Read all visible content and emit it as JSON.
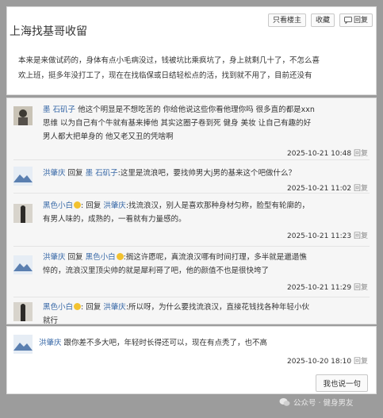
{
  "post": {
    "title": "上海找基哥收留",
    "buttons": {
      "only_author": "只看楼主",
      "favorite": "收藏",
      "reply": "回复"
    },
    "body_line1": "本来是来做试药的，身体有点小毛病没过，钱被坑比乘疯坑了，身上就剩几十了，不怎么喜",
    "body_line2": "欢上班，挺多年没打工了，现在在找临保或日结轻松点的活，找到就不用了，目前还没有"
  },
  "replies": [
    {
      "user": "墨 石矶子",
      "text_line1": "他这个明显是不想吃苦的 你给他说这些你看他理你吗 很多直的都是xxn",
      "text_line2": "思维 以为自己有个牛就有基来捧他 其实这圈子卷到死 健身 美妆 让自己有趣的好",
      "text_line3": "男人都大把单身的 他又老又丑的凭啥啊",
      "time": "2025-10-21 10:48",
      "reply_label": "回复"
    },
    {
      "user": "洪肇庆",
      "reply_to_prefix": "回复",
      "reply_to": "墨 石矶子",
      "text": ":这里是流浪吧，要找帅男大j男的基来这个吧做什么？",
      "time": "2025-10-21 11:02",
      "reply_label": "回复"
    },
    {
      "user": "黑色小白",
      "reply_to_prefix": "回复",
      "reply_to": "洪肇庆",
      "text_line1": ":找流浪汉，别人是喜欢那种身材匀称，脸型有轮廓的，",
      "text_line2": "有男人味的，成熟的，一看就有力量感的。",
      "time": "2025-10-21 11:23",
      "reply_label": "回复"
    },
    {
      "user": "洪肇庆",
      "reply_to_prefix": "回复",
      "reply_to": "黑色小白",
      "text_line1": ":搁这许愿呢，真流浪汉哪有时间打理，多半就是邋遢憔",
      "text_line2": "悴的，流浪汉里顶尖帅的就是犀利哥了吧，他的颜值不也是很快垮了",
      "time": "2025-10-21 11:29",
      "reply_label": "回复"
    },
    {
      "user": "黑色小白",
      "reply_to_prefix": "回复",
      "reply_to": "洪肇庆",
      "text_line1": ":所以呀，为什么要找流浪汉，直接花钱找各种年轻小伙",
      "text_line2": "就行"
    }
  ],
  "bottom_reply": {
    "user": "洪肇庆",
    "text": "跟你差不多大吧，年轻时长得还可以，现在有点秃了，也不高",
    "time": "2025-10-20 18:10",
    "reply_label": "回复",
    "say_button": "我也说一句"
  },
  "watermark": {
    "text": "公众号 · 健身男友"
  },
  "colors": {
    "username": "#3a6aa8",
    "background": "#9c9c9c"
  }
}
